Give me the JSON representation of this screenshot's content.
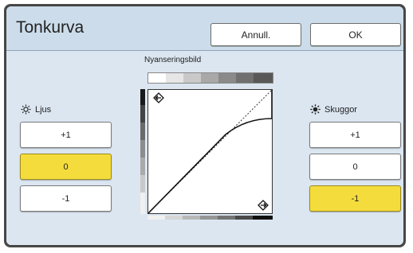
{
  "dialog": {
    "title": "Tonkurva",
    "cancel_label": "Annull.",
    "ok_label": "OK"
  },
  "gradation": {
    "label": "Nyanseringsbild",
    "curve_kind": "tone-curve-with-shadow-compression"
  },
  "highlights": {
    "label": "Ljus",
    "icon": "sun-outline-icon",
    "options": [
      "+1",
      "0",
      "-1"
    ],
    "selected": "0"
  },
  "shadows": {
    "label": "Skuggor",
    "icon": "sun-filled-icon",
    "options": [
      "+1",
      "0",
      "-1"
    ],
    "selected": "-1"
  },
  "colors": {
    "panel_bg": "#ccdcea",
    "body_bg": "#dbe6f1",
    "selected_bg": "#f4dc3c",
    "button_bg": "#ffffff"
  }
}
